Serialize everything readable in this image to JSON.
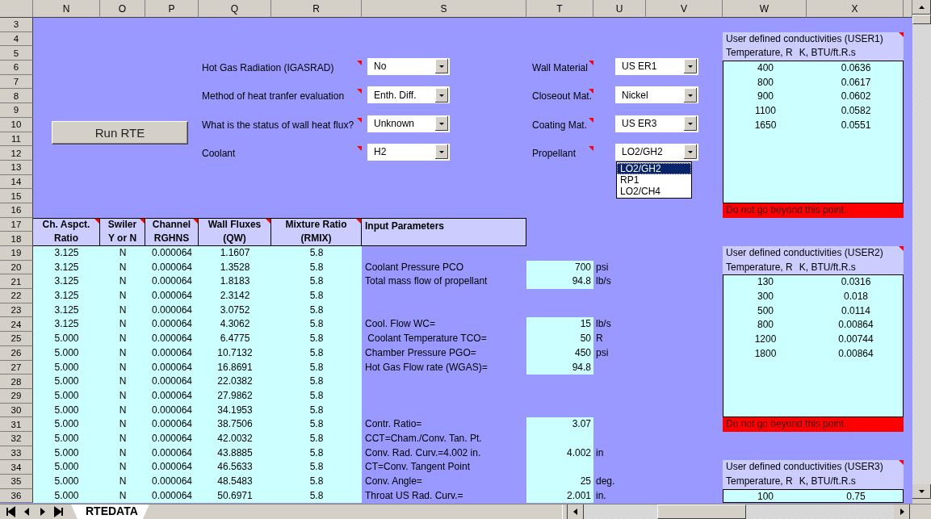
{
  "columns": [
    "N",
    "O",
    "P",
    "Q",
    "R",
    "S",
    "T",
    "U",
    "V",
    "W",
    "X"
  ],
  "row_numbers": [
    "3",
    "4",
    "5",
    "6",
    "7",
    "8",
    "9",
    "10",
    "11",
    "12",
    "13",
    "14",
    "15",
    "16",
    "17",
    "18",
    "19",
    "20",
    "21",
    "22",
    "23",
    "24",
    "25",
    "26",
    "27",
    "28",
    "29",
    "30",
    "31",
    "32",
    "33",
    "34",
    "35",
    "36"
  ],
  "run_button": "Run RTE",
  "left_settings": [
    {
      "label": "Hot Gas Radiation (IGASRAD)",
      "comment": true,
      "value": "No"
    },
    {
      "label": "Method of heat tranfer evaluation",
      "comment": true,
      "value": "Enth. Diff."
    },
    {
      "label": "What is the status of wall heat flux?",
      "comment": true,
      "value": "Unknown"
    },
    {
      "label": "Coolant",
      "comment": true,
      "value": "H2"
    }
  ],
  "right_settings": [
    {
      "label": "Wall Material",
      "comment": true,
      "value": "US ER1"
    },
    {
      "label": "Closeout Mat.",
      "comment": true,
      "value": "Nickel"
    },
    {
      "label": "Coating Mat.",
      "comment": true,
      "value": "US ER3"
    },
    {
      "label": "Propellant",
      "comment": true,
      "value": "LO2/GH2",
      "options": [
        {
          "label": "LO2/GH2",
          "selected": true
        },
        {
          "label": "RP1",
          "selected": false
        },
        {
          "label": "LO2/CH4",
          "selected": false
        }
      ]
    }
  ],
  "data_table": {
    "columns": [
      {
        "lines": [
          "Ch. Aspct.",
          "Ratio"
        ],
        "comment": true
      },
      {
        "lines": [
          "Swiler",
          "Y or N"
        ],
        "comment": true
      },
      {
        "lines": [
          "Channel",
          "RGHNS"
        ],
        "comment": true
      },
      {
        "lines": [
          "Wall Fluxes",
          "(QW)"
        ],
        "comment": true
      },
      {
        "lines": [
          "Mixture Ratio",
          "(RMIX)"
        ],
        "comment": true
      }
    ],
    "rows": [
      [
        "3.125",
        "N",
        "0.000064",
        "1.1607",
        "5.8"
      ],
      [
        "3.125",
        "N",
        "0.000064",
        "1.3528",
        "5.8"
      ],
      [
        "3.125",
        "N",
        "0.000064",
        "1.8183",
        "5.8"
      ],
      [
        "3.125",
        "N",
        "0.000064",
        "2.3142",
        "5.8"
      ],
      [
        "3.125",
        "N",
        "0.000064",
        "3.0752",
        "5.8"
      ],
      [
        "3.125",
        "N",
        "0.000064",
        "4.3062",
        "5.8"
      ],
      [
        "5.000",
        "N",
        "0.000064",
        "6.4775",
        "5.8"
      ],
      [
        "5.000",
        "N",
        "0.000064",
        "10.7132",
        "5.8"
      ],
      [
        "5.000",
        "N",
        "0.000064",
        "16.8691",
        "5.8"
      ],
      [
        "5.000",
        "N",
        "0.000064",
        "22.0382",
        "5.8"
      ],
      [
        "5.000",
        "N",
        "0.000064",
        "27.9862",
        "5.8"
      ],
      [
        "5.000",
        "N",
        "0.000064",
        "34.1953",
        "5.8"
      ],
      [
        "5.000",
        "N",
        "0.000064",
        "38.7506",
        "5.8"
      ],
      [
        "5.000",
        "N",
        "0.000064",
        "42.0032",
        "5.8"
      ],
      [
        "5.000",
        "N",
        "0.000064",
        "43.8885",
        "5.8"
      ],
      [
        "5.000",
        "N",
        "0.000064",
        "46.5633",
        "5.8"
      ],
      [
        "5.000",
        "N",
        "0.000064",
        "48.5483",
        "5.8"
      ],
      [
        "5.000",
        "N",
        "0.000064",
        "50.6971",
        "5.8"
      ]
    ]
  },
  "input_parameters": {
    "heading": "Input Parameters",
    "groups": [
      [
        {
          "label": "Coolant Pressure PCO",
          "value": "700",
          "unit": "psi"
        },
        {
          "label": "Total mass flow of propellant",
          "value": "94.8",
          "unit": "lb/s"
        }
      ],
      [
        {
          "label": "Cool. Flow WC=",
          "value": "15",
          "unit": "lb/s"
        },
        {
          "label": " Coolant Temperature TCO=",
          "value": "50",
          "unit": "R"
        },
        {
          "label": "Chamber Pressure PGO=",
          "value": "450",
          "unit": "psi"
        },
        {
          "label": "Hot Gas Flow rate (WGAS)=",
          "value": "94.8"
        }
      ],
      [
        {
          "label": "Contr. Ratio=",
          "value": "3.07"
        },
        {
          "label": "CCT=Cham./Conv. Tan. Pt."
        },
        {
          "label": "Conv. Rad. Curv.=4.002 in.",
          "value": "4.002",
          "unit": "in"
        },
        {
          "label": "CT=Conv. Tangent Point"
        },
        {
          "label": "Conv. Angle=",
          "value": "25",
          "unit": "deg."
        },
        {
          "label": "Throat US Rad. Curv.=",
          "value": "2.001",
          "unit": "in."
        }
      ]
    ]
  },
  "conductivity_tables": [
    {
      "title": "User defined conductivities (USER1)",
      "comment": true,
      "columns": [
        "Temperature, R",
        "K, BTU/ft.R.s"
      ],
      "rows": [
        [
          "400",
          "0.0636"
        ],
        [
          "800",
          "0.0617"
        ],
        [
          "900",
          "0.0602"
        ],
        [
          "1100",
          "0.0582"
        ],
        [
          "1650",
          "0.0551"
        ]
      ],
      "warning": "Do not go beyond this point."
    },
    {
      "title": "User defined conductivities (USER2)",
      "comment": true,
      "columns": [
        "Temperature, R",
        "K, BTU/ft.R.s"
      ],
      "rows": [
        [
          "130",
          "0.0316"
        ],
        [
          "300",
          "0.018"
        ],
        [
          "500",
          "0.0114"
        ],
        [
          "800",
          "0.00864"
        ],
        [
          "1200",
          "0.00744"
        ],
        [
          "1800",
          "0.00864"
        ]
      ],
      "warning": "Do not go beyond this point."
    },
    {
      "title": "User defined conductivities (USER3)",
      "comment": true,
      "columns": [
        "Temperature, R",
        "K, BTU/ft.R.s"
      ],
      "rows": [
        [
          "100",
          "0.75"
        ]
      ]
    }
  ],
  "sheet_tabs": [
    {
      "label": "RTEDATA",
      "selected": true
    }
  ]
}
